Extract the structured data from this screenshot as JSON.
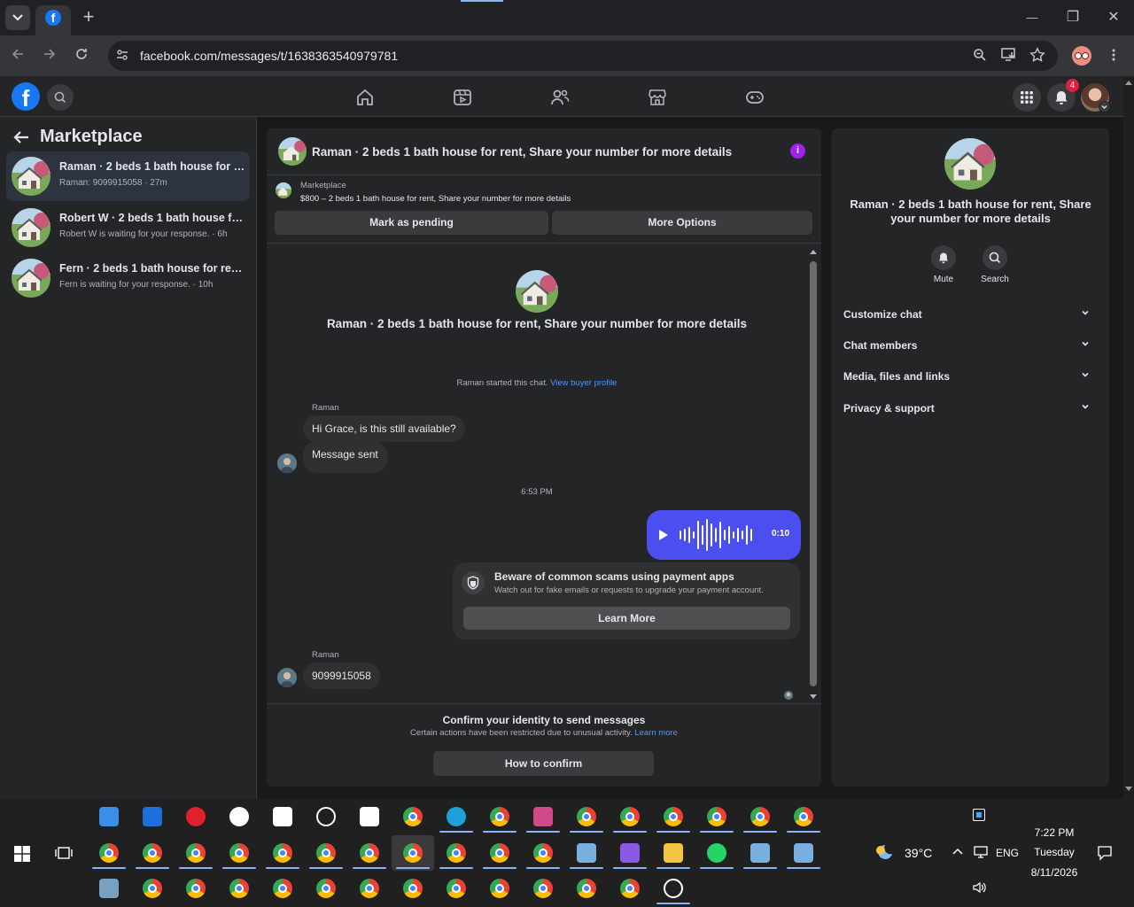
{
  "browser": {
    "url": "facebook.com/messages/t/1638363540979781",
    "new_tab": "+",
    "minimize": "—",
    "restore": "❐",
    "close": "✕"
  },
  "fb": {
    "notification_count": "4"
  },
  "left": {
    "title": "Marketplace",
    "conversations": [
      {
        "title": "Raman · 2 beds 1 bath house for re...",
        "subtitle": "Raman: 9099915058 · 27m"
      },
      {
        "title": "Robert W · 2 beds 1 bath house for...",
        "subtitle": "Robert W is waiting for your response. · 6h"
      },
      {
        "title": "Fern · 2 beds 1 bath house for rent...",
        "subtitle": "Fern is waiting for your response. · 10h"
      }
    ]
  },
  "chat": {
    "header_title": "Raman · 2 beds 1 bath house for rent, Share your number for more details",
    "listing_label": "Marketplace",
    "listing_detail": "$800 – 2 beds 1 bath house for rent, Share your number for more details",
    "mark_pending": "Mark as pending",
    "more_options": "More Options",
    "intro_title": "Raman · 2 beds 1 bath house for rent, Share your number for more details",
    "started_text": "Raman started this chat.",
    "view_buyer": "View buyer profile",
    "sender_name_1": "Raman",
    "msg_1": "Hi Grace, is this still available?",
    "msg_2": "Message sent",
    "timestamp": "6:53 PM",
    "voice_duration": "0:10",
    "scam_title": "Beware of common scams using payment apps",
    "scam_body": "Watch out for fake emails or requests to upgrade your payment account.",
    "learn_more_btn": "Learn More",
    "sender_name_2": "Raman",
    "msg_3": "9099915058",
    "confirm_title": "Confirm your identity to send messages",
    "confirm_body": "Certain actions have been restricted due to unusual activity.",
    "confirm_link": "Learn more",
    "how_to_confirm": "How to confirm"
  },
  "right": {
    "title": "Raman · 2 beds 1 bath house for rent, Share your number for more details",
    "mute": "Mute",
    "search": "Search",
    "sections": [
      "Customize chat",
      "Chat members",
      "Media, files and links",
      "Privacy & support"
    ]
  },
  "taskbar": {
    "weather": "39°C",
    "lang": "ENG",
    "time": "7:22 PM",
    "day": "Tuesday",
    "date": "8/11/2026"
  },
  "colors": {
    "accent": "#4b4ff0",
    "fb_blue": "#1877f2",
    "link": "#4599ff",
    "info": "#a020f0"
  }
}
